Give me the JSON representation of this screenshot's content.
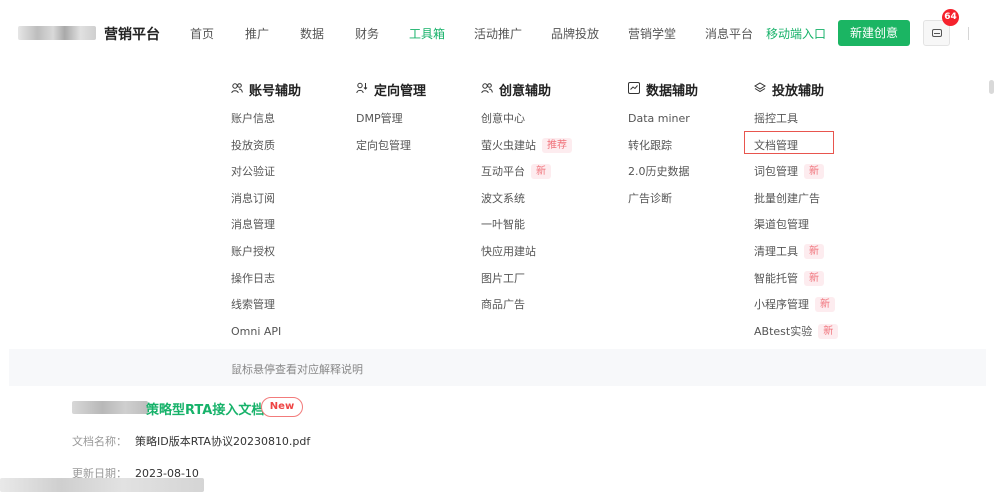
{
  "header": {
    "brand": "营销平台",
    "nav": [
      {
        "label": "首页",
        "x": 0
      },
      {
        "label": "推广"
      },
      {
        "label": "数据"
      },
      {
        "label": "财务"
      },
      {
        "label": "工具箱",
        "active": true
      },
      {
        "label": "活动推广"
      },
      {
        "label": "品牌投放"
      },
      {
        "label": "营销学堂"
      },
      {
        "label": "消息平台"
      }
    ],
    "mobile_entry": "移动端入口",
    "create_button": "新建创意",
    "message_count": "64"
  },
  "menu": {
    "columns": [
      {
        "title": "账号辅助",
        "icon": "users-icon",
        "items": [
          {
            "label": "账户信息"
          },
          {
            "label": "投放资质"
          },
          {
            "label": "对公验证"
          },
          {
            "label": "消息订阅"
          },
          {
            "label": "消息管理"
          },
          {
            "label": "账户授权"
          },
          {
            "label": "操作日志"
          },
          {
            "label": "线索管理"
          },
          {
            "label": "Omni API"
          }
        ]
      },
      {
        "title": "定向管理",
        "icon": "target-user-icon",
        "items": [
          {
            "label": "DMP管理"
          },
          {
            "label": "定向包管理"
          }
        ]
      },
      {
        "title": "创意辅助",
        "icon": "users-icon",
        "items": [
          {
            "label": "创意中心"
          },
          {
            "label": "萤火虫建站",
            "tag": "推荐"
          },
          {
            "label": "互动平台",
            "tag": "新"
          },
          {
            "label": "波文系统"
          },
          {
            "label": "一叶智能"
          },
          {
            "label": "快应用建站"
          },
          {
            "label": "图片工厂"
          },
          {
            "label": "商品广告"
          }
        ]
      },
      {
        "title": "数据辅助",
        "icon": "chart-box-icon",
        "items": [
          {
            "label": "Data miner"
          },
          {
            "label": "转化跟踪"
          },
          {
            "label": "2.0历史数据"
          },
          {
            "label": "广告诊断"
          }
        ]
      },
      {
        "title": "投放辅助",
        "icon": "layers-icon",
        "items": [
          {
            "label": "摇控工具"
          },
          {
            "label": "文档管理"
          },
          {
            "label": "词包管理",
            "tag": "新"
          },
          {
            "label": "批量创建广告"
          },
          {
            "label": "渠道包管理"
          },
          {
            "label": "清理工具",
            "tag": "新"
          },
          {
            "label": "智能托管",
            "tag": "新"
          },
          {
            "label": "小程序管理",
            "tag": "新"
          },
          {
            "label": "ABtest实验",
            "tag": "新"
          }
        ]
      }
    ],
    "hint": "鼠标悬停查看对应解释说明"
  },
  "document": {
    "title": "策略型RTA接入文档协议",
    "badge": "New",
    "name_label": "文档名称：",
    "name_value": "策略ID版本RTA协议20230810.pdf",
    "date_label": "更新日期：",
    "date_value": "2023-08-10"
  }
}
